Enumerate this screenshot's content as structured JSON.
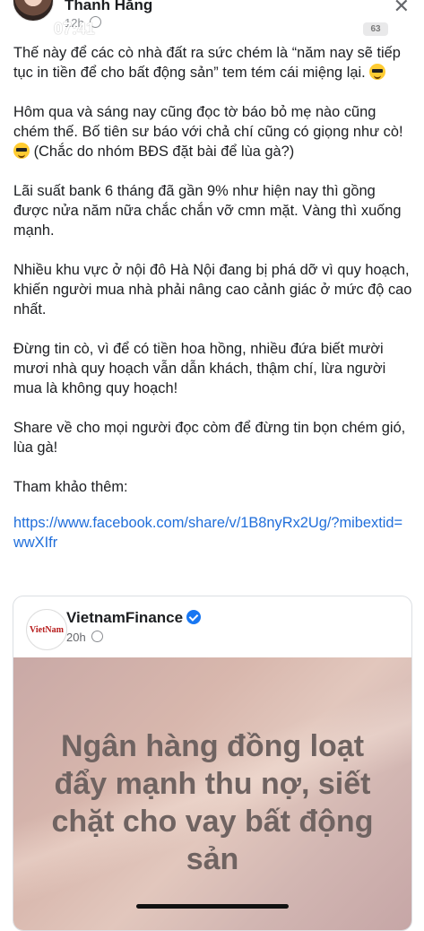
{
  "status_bar": {
    "time": "07:41",
    "battery": "63"
  },
  "post": {
    "author": "Thanh Hằng",
    "time": "12h",
    "paragraphs": [
      "Thế này để các cò nhà đất ra sức chém là “năm nay sẽ tiếp tục in tiền để cho bất động sản” tem tém cái miệng lại.",
      "Hôm qua và sáng nay cũng đọc tờ báo bỏ mẹ nào cũng chém thế. Bố tiên sư báo với chả chí cũng có giọng như cò!",
      "(Chắc do nhóm BĐS đặt bài để lùa gà?)",
      "Lãi suất bank 6 tháng đã gần 9% như hiện nay thì gồng được nửa năm nữa chắc chắn vỡ cmn mặt. Vàng thì xuống mạnh.",
      "Nhiều khu vực ở nội đô Hà Nội đang bị phá dỡ vì quy hoạch, khiến người mua nhà phải nâng cao cảnh giác ở mức độ cao nhất.",
      "Đừng tin cò, vì để có tiền hoa hồng, nhiều đứa biết mười mươi nhà quy hoạch vẫn dẫn khách, thậm chí, lừa người mua là không quy hoạch!",
      "Share về cho mọi người đọc còm để đừng tin bọn chém gió, lùa gà!",
      "Tham khảo thêm:"
    ],
    "link": "https://www.facebook.com/share/v/1B8nyRx2Ug/?mibextid=wwXIfr"
  },
  "shared": {
    "logo_text": "VietNam",
    "page_name": "VietnamFinance",
    "time": "20h",
    "headline": "Ngân hàng đồng loạt đẩy mạnh thu nợ, siết chặt cho vay bất động sản"
  },
  "icons": [
    "close-icon",
    "globe-icon",
    "verified-icon",
    "emoji-sunglasses-icon",
    "signal-icon",
    "wifi-icon",
    "battery-icon"
  ]
}
